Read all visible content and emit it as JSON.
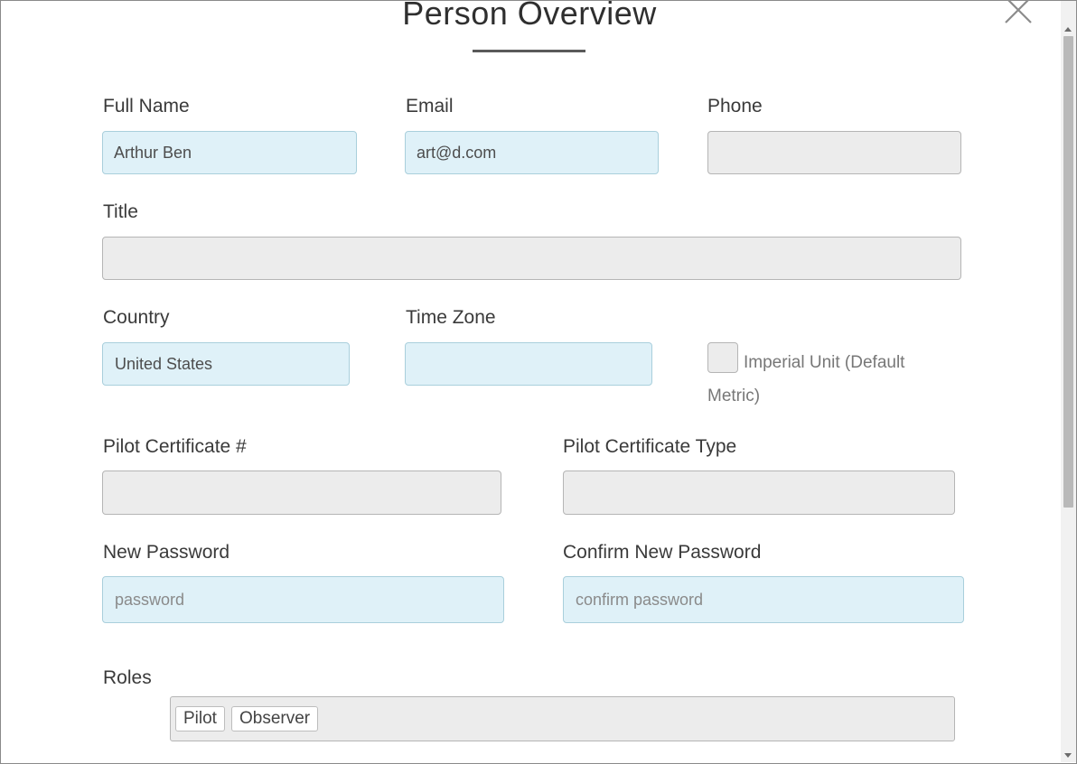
{
  "dialog": {
    "title": "Person Overview"
  },
  "fields": {
    "full_name": {
      "label": "Full Name",
      "value": "Arthur Ben"
    },
    "email": {
      "label": "Email",
      "value": "art@d.com"
    },
    "phone": {
      "label": "Phone",
      "value": ""
    },
    "title": {
      "label": "Title",
      "value": ""
    },
    "country": {
      "label": "Country",
      "value": "United States"
    },
    "time_zone": {
      "label": "Time Zone",
      "value": ""
    },
    "imperial_unit": {
      "label": "Imperial Unit (Default Metric)"
    },
    "pilot_cert_number": {
      "label": "Pilot Certificate #",
      "value": ""
    },
    "pilot_cert_type": {
      "label": "Pilot Certificate Type",
      "value": ""
    },
    "new_password": {
      "label": "New Password",
      "placeholder": "password"
    },
    "confirm_password": {
      "label": "Confirm New Password",
      "placeholder": "confirm password"
    },
    "roles": {
      "label": "Roles",
      "items": [
        "Pilot",
        "Observer"
      ]
    }
  },
  "icons": {
    "close": "close-icon"
  },
  "colors": {
    "editable_field": "#dff1f8",
    "disabled_field": "#ececec"
  }
}
